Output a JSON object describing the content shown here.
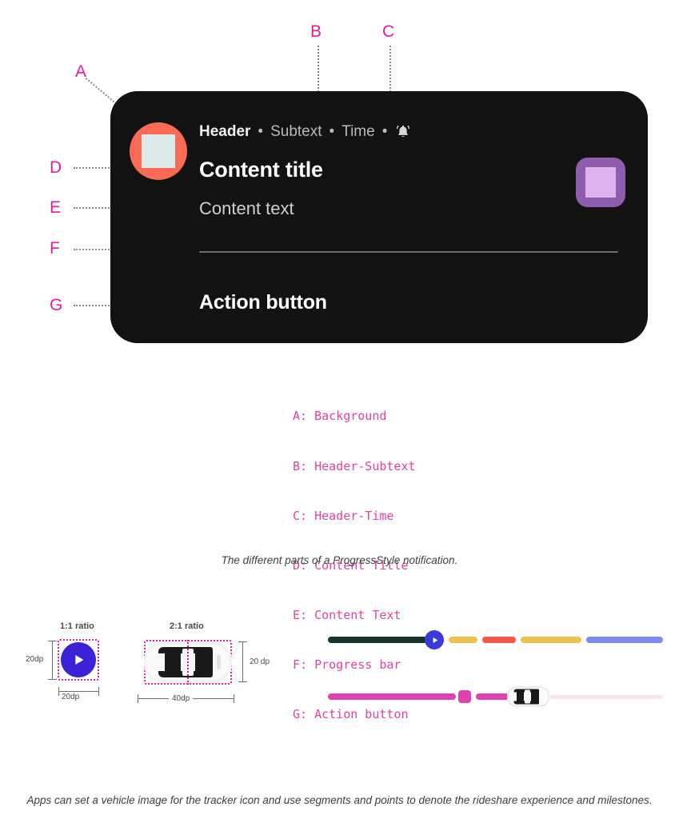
{
  "annotations": {
    "a": "A",
    "b": "B",
    "c": "C",
    "d": "D",
    "e": "E",
    "f": "F",
    "g": "G"
  },
  "notification": {
    "header": {
      "app_name": "Header",
      "subtext": "Subtext",
      "time": "Time",
      "separator": "•",
      "bell_icon": "bell-icon"
    },
    "avatar_icon": "app-avatar-icon",
    "content_title": "Content title",
    "content_text": "Content text",
    "right_icon": "large-picture-icon",
    "action_button": "Action button",
    "colors": {
      "background": "#121212",
      "avatar": "#f96b54",
      "avatar_glyph": "#dceaea",
      "right_icon": "#8f5dad",
      "right_icon_glyph": "#dcb3ee",
      "progress_track": "#6d6d6d",
      "title": "#ffffff",
      "body": "#cfcfcf"
    }
  },
  "legend": {
    "accent_color": "#e0449f",
    "items": [
      "A: Background",
      "B: Header-Subtext",
      "C: Header-Time",
      "D: Content Title",
      "E: Content Text",
      "F: Progress bar",
      "G: Action button"
    ]
  },
  "captions": {
    "middle": "The different parts of a ProgressStyle notification.",
    "bottom": "Apps can set a vehicle image for the tracker icon and use segments and points to denote the rideshare experience and milestones."
  },
  "ratio_diagrams": [
    {
      "title": "1:1 ratio",
      "icon": "play-circle-icon",
      "icon_color": "#3b22d6",
      "width_label": "20dp",
      "height_label": "20dp"
    },
    {
      "title": "2:1 ratio",
      "icon": "car-top-view-icon",
      "width_label": "40dp",
      "height_label": "20 dp"
    }
  ],
  "progress_examples": [
    {
      "name": "segmented-progress-with-play-tracker",
      "tracker_icon": "play-circle-icon",
      "tracker_color": "#3b3ad6",
      "segments": [
        {
          "color": "#173525",
          "label": "completed"
        },
        {
          "color": "#edc14f",
          "label": "segment-2"
        },
        {
          "color": "#f0594b",
          "label": "segment-3"
        },
        {
          "color": "#edc14f",
          "label": "segment-4"
        },
        {
          "color": "#7b8ced",
          "label": "segment-5"
        }
      ]
    },
    {
      "name": "rideshare-progress-with-car-tracker",
      "tracker_icon": "car-top-view-icon",
      "point_marker_color": "#e040b0",
      "segments": [
        {
          "color": "#e040b0",
          "label": "completed"
        },
        {
          "color": "#e040b0",
          "label": "segment-2"
        },
        {
          "color": "#fbe4ef",
          "label": "remaining"
        }
      ]
    }
  ]
}
